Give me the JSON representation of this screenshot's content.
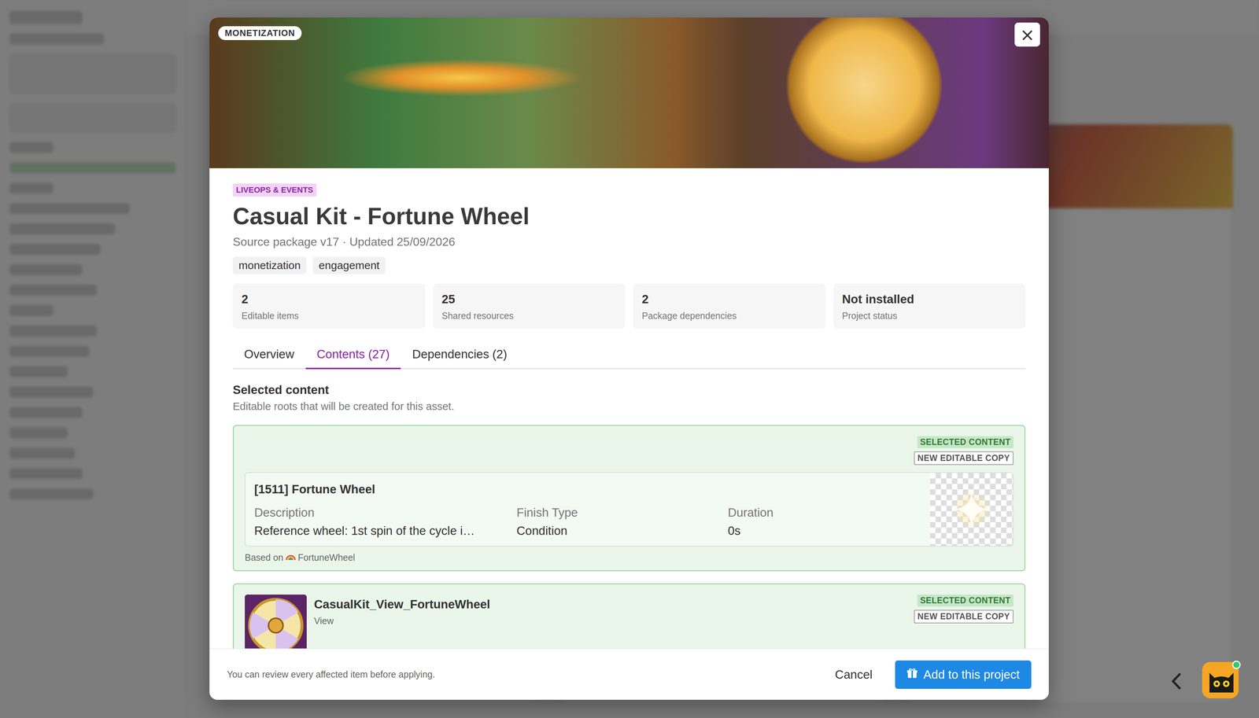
{
  "banner": {
    "badge": "MONETIZATION",
    "close": "×"
  },
  "category": "LIVEOPS & EVENTS",
  "title": "Casual Kit - Fortune Wheel",
  "subtitle": "Source package v17 · Updated 25/09/2026",
  "tags": [
    "monetization",
    "engagement"
  ],
  "stats": [
    {
      "value": "2",
      "label": "Editable items"
    },
    {
      "value": "25",
      "label": "Shared resources"
    },
    {
      "value": "2",
      "label": "Package dependencies"
    },
    {
      "value": "Not installed",
      "label": "Project status"
    }
  ],
  "tabs": [
    {
      "label": "Overview",
      "selected": false
    },
    {
      "label": "Contents (27)",
      "selected": true
    },
    {
      "label": "Dependencies (2)",
      "selected": false
    }
  ],
  "section": {
    "title": "Selected content",
    "subtitle": "Editable roots that will be created for this asset."
  },
  "items": [
    {
      "kind": "record",
      "badges": [
        {
          "label": "SELECTED CONTENT",
          "kind": "status"
        },
        {
          "label": "NEW EDITABLE COPY",
          "kind": "tag"
        }
      ],
      "name": "[1511] Fortune Wheel",
      "fields": [
        {
          "label": "Description",
          "value": "Reference wheel: 1st spin of the cycle i…"
        },
        {
          "label": "Finish Type",
          "value": "Condition"
        },
        {
          "label": "Duration",
          "value": "0s"
        }
      ],
      "based_on_label": "Based on",
      "based_on": "FortuneWheel"
    },
    {
      "kind": "view",
      "badges": [
        {
          "label": "SELECTED CONTENT",
          "kind": "status"
        },
        {
          "label": "NEW EDITABLE COPY",
          "kind": "tag"
        }
      ],
      "name": "CasualKit_View_FortuneWheel",
      "type": "View"
    }
  ],
  "footer": {
    "note": "You can review every affected item before applying.",
    "cancel": "Cancel",
    "confirm": "Add to this project"
  }
}
